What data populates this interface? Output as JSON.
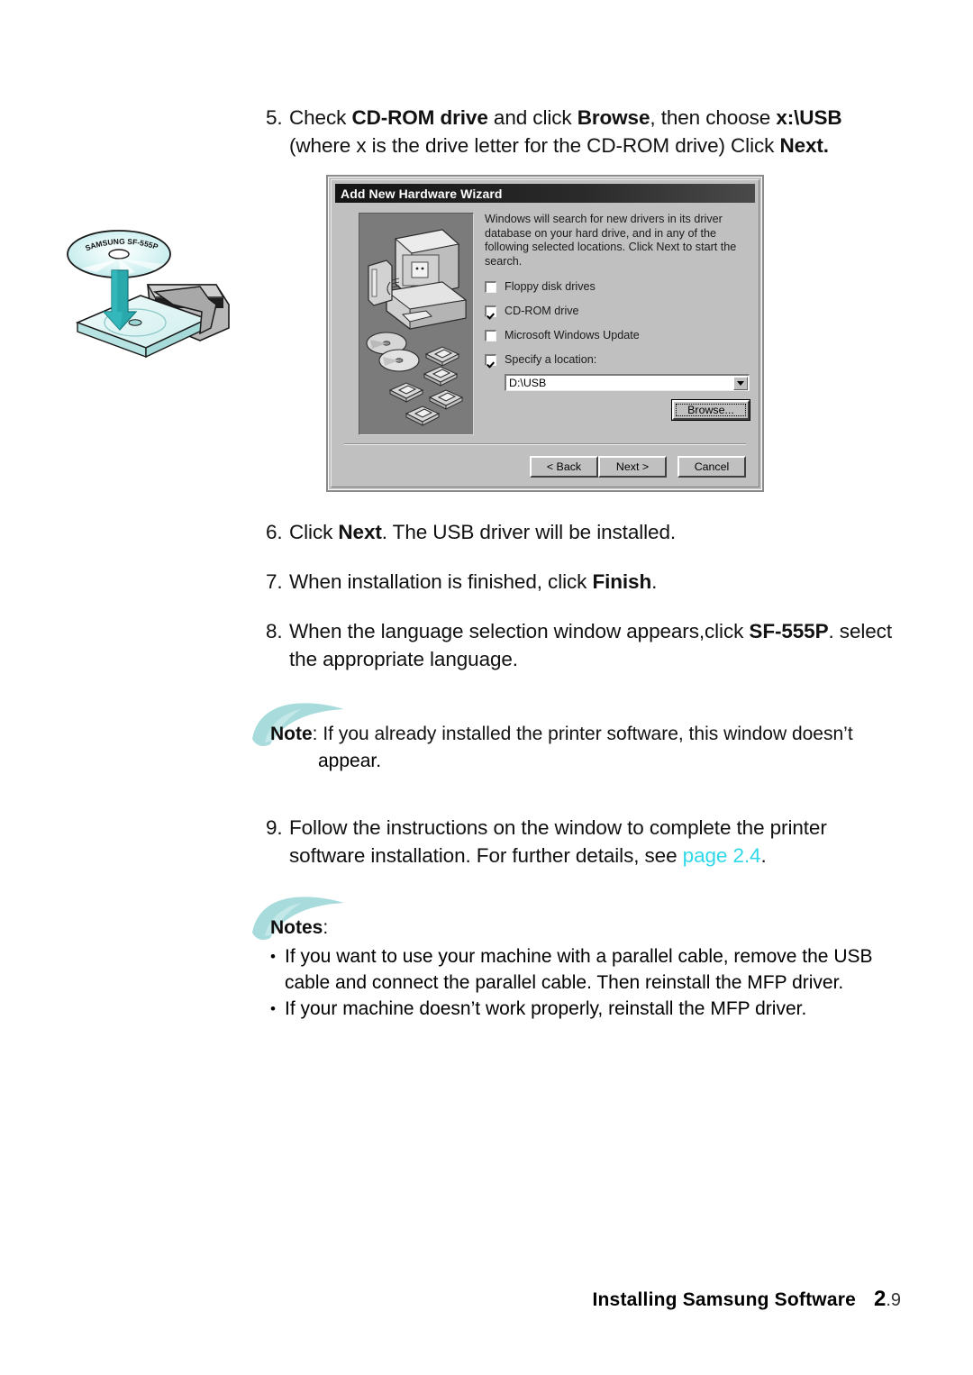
{
  "steps": [
    {
      "number": "5.",
      "parts": [
        {
          "t": "Check ",
          "b": false
        },
        {
          "t": "CD-ROM drive",
          "b": true
        },
        {
          "t": " and click ",
          "b": false
        },
        {
          "t": "Browse",
          "b": true
        },
        {
          "t": ", then choose ",
          "b": false
        },
        {
          "t": "x:\\USB",
          "b": true
        },
        {
          "t": " (where x is the drive letter for the CD-ROM drive) Click ",
          "b": false
        },
        {
          "t": "Next.",
          "b": true
        }
      ]
    },
    {
      "number": "6.",
      "parts": [
        {
          "t": "Click ",
          "b": false
        },
        {
          "t": "Next",
          "b": true
        },
        {
          "t": ". The USB driver will be installed.",
          "b": false
        }
      ]
    },
    {
      "number": "7.",
      "parts": [
        {
          "t": "When installation is finished, click ",
          "b": false
        },
        {
          "t": "Finish",
          "b": true
        },
        {
          "t": ".",
          "b": false
        }
      ]
    },
    {
      "number": "8.",
      "parts": [
        {
          "t": "When the language selection window appears,click ",
          "b": false
        },
        {
          "t": "SF-555P",
          "b": true
        },
        {
          "t": ". select the appropriate language.",
          "b": false
        }
      ]
    },
    {
      "number": "9.",
      "parts": [
        {
          "t": "Follow the instructions on the window to complete the printer software installation. For further details, see ",
          "b": false
        },
        {
          "t": "page 2.4",
          "b": false,
          "teal": true
        },
        {
          "t": ".",
          "b": false
        }
      ]
    }
  ],
  "note_single": {
    "label": "Note",
    "colon": ":",
    "line1": " If you already installed the printer software, this window doesn’t",
    "line2": "appear."
  },
  "notes_block": {
    "label": "Notes",
    "colon": ":",
    "bullet_glyph": "•",
    "items": [
      "If you want to use your machine with a parallel cable, remove the USB cable and connect the parallel cable. Then reinstall the MFP driver.",
      "If your machine doesn’t work properly, reinstall the MFP driver."
    ]
  },
  "cd_illustration": {
    "disc_label": "SAMSUNG SF-555P",
    "arrow_color": "#2aa9ad",
    "tray_color": "#d9f3f2",
    "drive_color": "#b3b3b3"
  },
  "wizard": {
    "title": "Add New Hardware Wizard",
    "paragraph": "Windows will search for new drivers in its driver database on your hard drive, and in any of the following selected locations. Click Next to start the search.",
    "checkboxes": [
      {
        "label": "Floppy disk drives",
        "accel": "F",
        "checked": false
      },
      {
        "label": "CD-ROM drive",
        "accel": "C",
        "checked": true
      },
      {
        "label": "Microsoft Windows Update",
        "accel": "M",
        "checked": false
      },
      {
        "label": "Specify a location:",
        "accel": "l",
        "checked": true
      }
    ],
    "location_value": "D:\\USB",
    "browse_label": "Browse...",
    "buttons": [
      {
        "label": "< Back"
      },
      {
        "label": "Next >"
      },
      {
        "label": "Cancel"
      }
    ],
    "colors": {
      "face": "#c0c0c0",
      "titlebar": "#1a1a1a",
      "illustration_bg": "#7b7b7b"
    }
  },
  "footer": {
    "title": "Installing Samsung Software",
    "page_major": "2",
    "page_minor": ".9"
  }
}
